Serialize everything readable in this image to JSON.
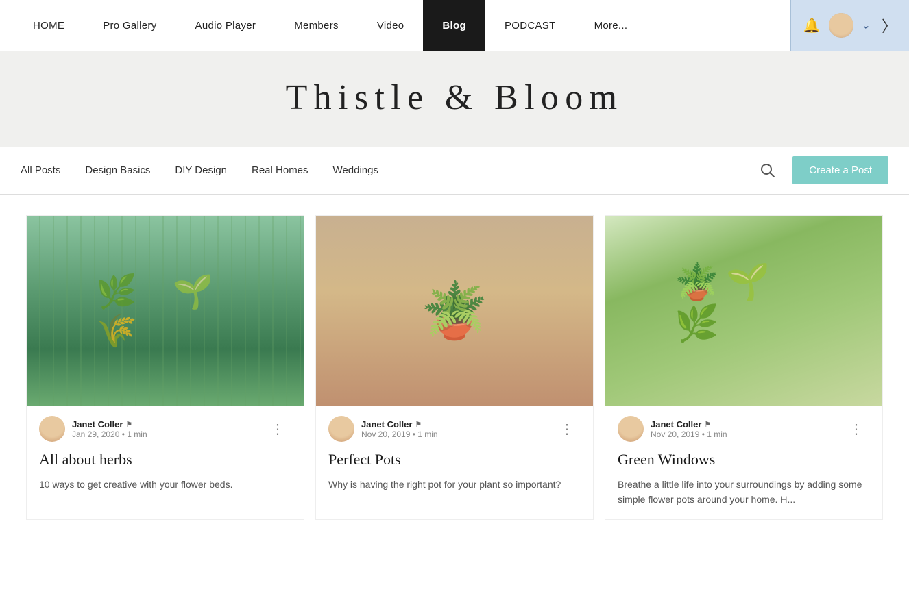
{
  "nav": {
    "items": [
      {
        "id": "home",
        "label": "HOME",
        "active": false
      },
      {
        "id": "pro-gallery",
        "label": "Pro Gallery",
        "active": false
      },
      {
        "id": "audio-player",
        "label": "Audio Player",
        "active": false
      },
      {
        "id": "members",
        "label": "Members",
        "active": false
      },
      {
        "id": "video",
        "label": "Video",
        "active": false
      },
      {
        "id": "blog",
        "label": "Blog",
        "active": true
      },
      {
        "id": "podcast",
        "label": "PODCAST",
        "active": false
      },
      {
        "id": "more",
        "label": "More...",
        "active": false
      }
    ]
  },
  "hero": {
    "title": "Thistle & Bloom"
  },
  "filter": {
    "items": [
      {
        "id": "all-posts",
        "label": "All Posts"
      },
      {
        "id": "design-basics",
        "label": "Design Basics"
      },
      {
        "id": "diy-design",
        "label": "DIY Design"
      },
      {
        "id": "real-homes",
        "label": "Real Homes"
      },
      {
        "id": "weddings",
        "label": "Weddings"
      }
    ],
    "create_post_label": "Create a Post"
  },
  "posts": [
    {
      "id": "post-1",
      "author": "Janet Coller",
      "date": "Jan 29, 2020",
      "read_time": "1 min",
      "title": "All about herbs",
      "excerpt": "10 ways to get creative with your flower beds.",
      "image_type": "herbs"
    },
    {
      "id": "post-2",
      "author": "Janet Coller",
      "date": "Nov 20, 2019",
      "read_time": "1 min",
      "title": "Perfect Pots",
      "excerpt": "Why is having the right pot for your plant so important?",
      "image_type": "pots"
    },
    {
      "id": "post-3",
      "author": "Janet Coller",
      "date": "Nov 20, 2019",
      "read_time": "1 min",
      "title": "Green Windows",
      "excerpt": "Breathe a little life into your surroundings by adding some simple flower pots around your home. H...",
      "image_type": "windows"
    }
  ],
  "colors": {
    "nav_active_bg": "#1a1a1a",
    "nav_right_bg": "#d0dff0",
    "create_post_bg": "#7ecec8",
    "hero_bg": "#f0f0ee"
  }
}
